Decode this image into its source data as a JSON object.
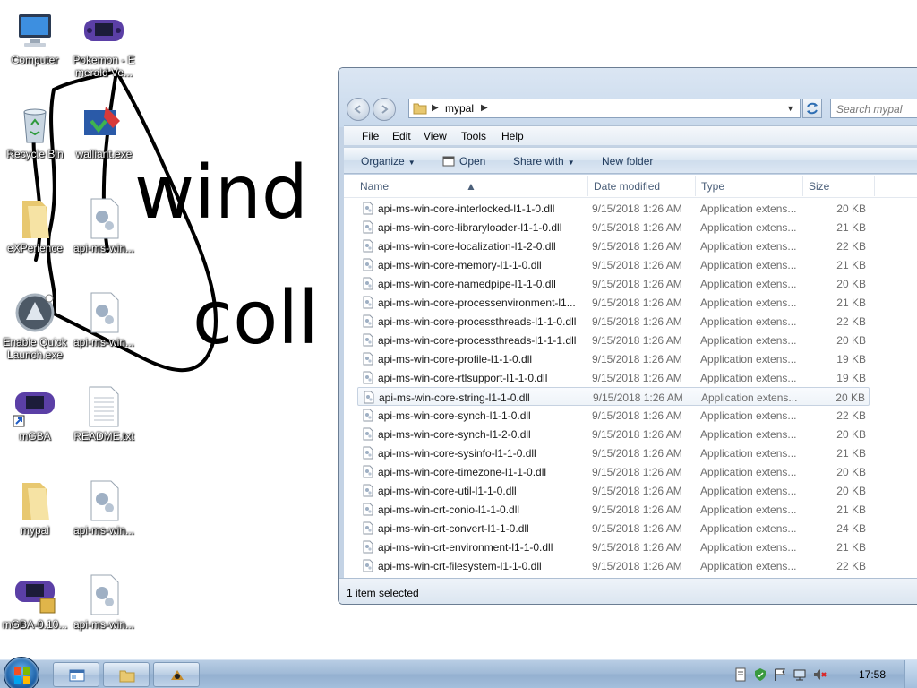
{
  "desktop": {
    "icons": [
      {
        "label": "Computer",
        "icon": "computer-icon"
      },
      {
        "label": "Pokemon - Emerald Ve...",
        "icon": "gba-icon"
      },
      {
        "label": "Recycle Bin",
        "icon": "recycle-bin-icon"
      },
      {
        "label": "walliant.exe",
        "icon": "walliant-icon"
      },
      {
        "label": "eXPerience",
        "icon": "folder-icon"
      },
      {
        "label": "api-ms-win...",
        "icon": "dll-file-icon"
      },
      {
        "label": "Enable Quick Launch.exe",
        "icon": "quick-launch-icon"
      },
      {
        "label": "api-ms-win...",
        "icon": "dll-file-icon"
      },
      {
        "label": "mGBA",
        "icon": "gba-shortcut-icon"
      },
      {
        "label": "README.txt",
        "icon": "text-file-icon"
      },
      {
        "label": "mypal",
        "icon": "folder-icon"
      },
      {
        "label": "api-ms-win...",
        "icon": "dll-file-icon"
      },
      {
        "label": "mGBA-0.10...",
        "icon": "gba-archive-icon"
      },
      {
        "label": "api-ms-win...",
        "icon": "dll-file-icon"
      }
    ],
    "wallpaper_text": [
      "wind",
      "coll"
    ]
  },
  "explorer": {
    "address": {
      "crumb": "mypal"
    },
    "search": {
      "placeholder": "Search mypal"
    },
    "menu": {
      "file": "File",
      "edit": "Edit",
      "view": "View",
      "tools": "Tools",
      "help": "Help"
    },
    "toolbar": {
      "organize": "Organize",
      "open": "Open",
      "share_with": "Share with",
      "new_folder": "New folder"
    },
    "columns": {
      "name": "Name",
      "date": "Date modified",
      "type": "Type",
      "size": "Size"
    },
    "files": [
      {
        "name": "api-ms-win-core-interlocked-l1-1-0.dll",
        "date": "9/15/2018 1:26 AM",
        "type": "Application extens...",
        "size": "20 KB"
      },
      {
        "name": "api-ms-win-core-libraryloader-l1-1-0.dll",
        "date": "9/15/2018 1:26 AM",
        "type": "Application extens...",
        "size": "21 KB"
      },
      {
        "name": "api-ms-win-core-localization-l1-2-0.dll",
        "date": "9/15/2018 1:26 AM",
        "type": "Application extens...",
        "size": "22 KB"
      },
      {
        "name": "api-ms-win-core-memory-l1-1-0.dll",
        "date": "9/15/2018 1:26 AM",
        "type": "Application extens...",
        "size": "21 KB"
      },
      {
        "name": "api-ms-win-core-namedpipe-l1-1-0.dll",
        "date": "9/15/2018 1:26 AM",
        "type": "Application extens...",
        "size": "20 KB"
      },
      {
        "name": "api-ms-win-core-processenvironment-l1...",
        "date": "9/15/2018 1:26 AM",
        "type": "Application extens...",
        "size": "21 KB"
      },
      {
        "name": "api-ms-win-core-processthreads-l1-1-0.dll",
        "date": "9/15/2018 1:26 AM",
        "type": "Application extens...",
        "size": "22 KB"
      },
      {
        "name": "api-ms-win-core-processthreads-l1-1-1.dll",
        "date": "9/15/2018 1:26 AM",
        "type": "Application extens...",
        "size": "20 KB"
      },
      {
        "name": "api-ms-win-core-profile-l1-1-0.dll",
        "date": "9/15/2018 1:26 AM",
        "type": "Application extens...",
        "size": "19 KB"
      },
      {
        "name": "api-ms-win-core-rtlsupport-l1-1-0.dll",
        "date": "9/15/2018 1:26 AM",
        "type": "Application extens...",
        "size": "19 KB"
      },
      {
        "name": "api-ms-win-core-string-l1-1-0.dll",
        "date": "9/15/2018 1:26 AM",
        "type": "Application extens...",
        "size": "20 KB",
        "selected": true
      },
      {
        "name": "api-ms-win-core-synch-l1-1-0.dll",
        "date": "9/15/2018 1:26 AM",
        "type": "Application extens...",
        "size": "22 KB"
      },
      {
        "name": "api-ms-win-core-synch-l1-2-0.dll",
        "date": "9/15/2018 1:26 AM",
        "type": "Application extens...",
        "size": "20 KB"
      },
      {
        "name": "api-ms-win-core-sysinfo-l1-1-0.dll",
        "date": "9/15/2018 1:26 AM",
        "type": "Application extens...",
        "size": "21 KB"
      },
      {
        "name": "api-ms-win-core-timezone-l1-1-0.dll",
        "date": "9/15/2018 1:26 AM",
        "type": "Application extens...",
        "size": "20 KB"
      },
      {
        "name": "api-ms-win-core-util-l1-1-0.dll",
        "date": "9/15/2018 1:26 AM",
        "type": "Application extens...",
        "size": "20 KB"
      },
      {
        "name": "api-ms-win-crt-conio-l1-1-0.dll",
        "date": "9/15/2018 1:26 AM",
        "type": "Application extens...",
        "size": "21 KB"
      },
      {
        "name": "api-ms-win-crt-convert-l1-1-0.dll",
        "date": "9/15/2018 1:26 AM",
        "type": "Application extens...",
        "size": "24 KB"
      },
      {
        "name": "api-ms-win-crt-environment-l1-1-0.dll",
        "date": "9/15/2018 1:26 AM",
        "type": "Application extens...",
        "size": "21 KB"
      },
      {
        "name": "api-ms-win-crt-filesystem-l1-1-0.dll",
        "date": "9/15/2018 1:26 AM",
        "type": "Application extens...",
        "size": "22 KB"
      }
    ],
    "status": "1 item selected"
  },
  "taskbar": {
    "clock": "17:58",
    "buttons": [
      "explorer-app-icon",
      "folder-icon",
      "walliant-icon"
    ]
  },
  "colors": {
    "selection_bg": "#eef3f8",
    "window_frame": "#c4d3e5",
    "taskbar": "#a4bfdc"
  }
}
